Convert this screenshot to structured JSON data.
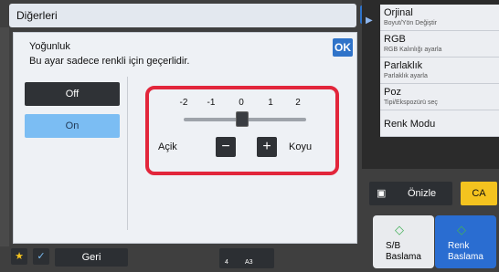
{
  "top_bar": {
    "title": "Diğerleri",
    "ok": "OK"
  },
  "dialog": {
    "title": "Yoğunluk",
    "subtitle": "Bu ayar sadece renkli için geçerlidir.",
    "ok": "OK",
    "toggle": {
      "off": "Off",
      "on": "On",
      "selected": "On"
    },
    "slider": {
      "ticks": [
        "-2",
        "-1",
        "0",
        "1",
        "2"
      ],
      "value": 0,
      "left_label": "Açik",
      "right_label": "Koyu",
      "minus": "−",
      "plus": "+"
    }
  },
  "right_menu": [
    {
      "title": "Orjinal",
      "sub": "Boyut/Yön Değiştir"
    },
    {
      "title": "RGB",
      "sub": "RGB Kalınlığı ayarla"
    },
    {
      "title": "Parlaklık",
      "sub": "Parlaklık ayarla"
    },
    {
      "title": "Poz",
      "sub": "Tipi/Ekspozürü seç"
    },
    {
      "title": "Renk Modu",
      "sub": ""
    }
  ],
  "bottom": {
    "back": "Geri",
    "page_small": "4",
    "paper_small": "A3"
  },
  "actions": {
    "preview": "Önizle",
    "ca": "CA",
    "start_bw": {
      "t1": "S/B",
      "t2": "Baslama"
    },
    "start_color": {
      "t1": "Renk",
      "t2": "Baslama"
    }
  },
  "colors": {
    "accent_blue": "#2f73c9",
    "highlight_red": "#e2263b",
    "ca_yellow": "#f4c31f"
  }
}
